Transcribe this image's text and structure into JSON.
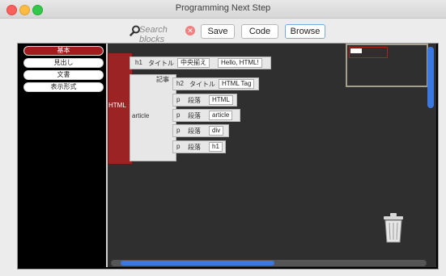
{
  "window": {
    "title": "Programming Next Step"
  },
  "toolbar": {
    "search_placeholder": "Search blocks",
    "save_label": "Save",
    "code_label": "Code",
    "browse_label": "Browse"
  },
  "sidebar": {
    "categories": [
      {
        "label": "基本",
        "active": true
      },
      {
        "label": "見出し",
        "active": false
      },
      {
        "label": "文書",
        "active": false
      },
      {
        "label": "表示形式",
        "active": false
      }
    ]
  },
  "blocks": {
    "html_label": "HTML",
    "article_label": "article",
    "h1": {
      "tag": "h1",
      "kind": "タイトル",
      "style": "中央揃え",
      "text": "Hello, HTML!"
    },
    "section_label": "記事",
    "h2": {
      "tag": "h2",
      "kind": "タイトル",
      "text": "HTML Tag"
    },
    "paragraphs": [
      {
        "tag": "p",
        "kind": "段落",
        "text": "HTML"
      },
      {
        "tag": "p",
        "kind": "段落",
        "text": "article"
      },
      {
        "tag": "p",
        "kind": "段落",
        "text": "div"
      },
      {
        "tag": "p",
        "kind": "段落",
        "text": "h1"
      }
    ]
  },
  "colors": {
    "accent": "#3b78e0",
    "html_block": "#9b2323",
    "canvas": "#2f2f2f"
  },
  "icons": {
    "search": "search-icon",
    "clear": "clear-icon",
    "trash": "trash-icon"
  }
}
